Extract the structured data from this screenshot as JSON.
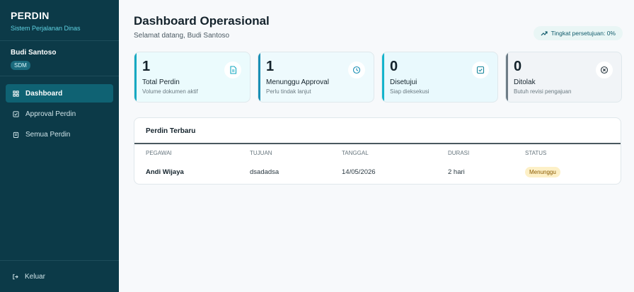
{
  "brand": {
    "title": "PERDIN",
    "subtitle": "Sistem Perjalanan Dinas"
  },
  "user": {
    "name": "Budi Santoso",
    "role": "SDM"
  },
  "nav": [
    {
      "label": "Dashboard",
      "icon": "grid-icon",
      "active": true
    },
    {
      "label": "Approval Perdin",
      "icon": "check-square-icon",
      "active": false
    },
    {
      "label": "Semua Perdin",
      "icon": "clipboard-icon",
      "active": false
    }
  ],
  "logout_label": "Keluar",
  "header": {
    "title": "Dashboard Operasional",
    "greeting": "Selamat datang, Budi Santoso",
    "approval_rate": "Tingkat persetujuan: 0%"
  },
  "cards": [
    {
      "value": "1",
      "label": "Total Perdin",
      "desc": "Volume dokumen aktif",
      "icon": "document-icon"
    },
    {
      "value": "1",
      "label": "Menunggu Approval",
      "desc": "Perlu tindak lanjut",
      "icon": "clock-icon"
    },
    {
      "value": "0",
      "label": "Disetujui",
      "desc": "Siap dieksekusi",
      "icon": "check-square-icon"
    },
    {
      "value": "0",
      "label": "Ditolak",
      "desc": "Butuh revisi pengajuan",
      "icon": "x-circle-icon"
    }
  ],
  "recent": {
    "title": "Perdin Terbaru",
    "columns": [
      "PEGAWAI",
      "TUJUAN",
      "TANGGAL",
      "DURASI",
      "STATUS"
    ],
    "rows": [
      {
        "pegawai": "Andi Wijaya",
        "tujuan": "dsadadsa",
        "tanggal": "14/05/2026",
        "durasi": "2 hari",
        "status": "Menunggu"
      }
    ]
  },
  "colors": {
    "sidebar": "#0c3a48",
    "accent": "#16a9c2",
    "active_nav": "#0f6273",
    "pending_badge": "#fdf0c7"
  }
}
